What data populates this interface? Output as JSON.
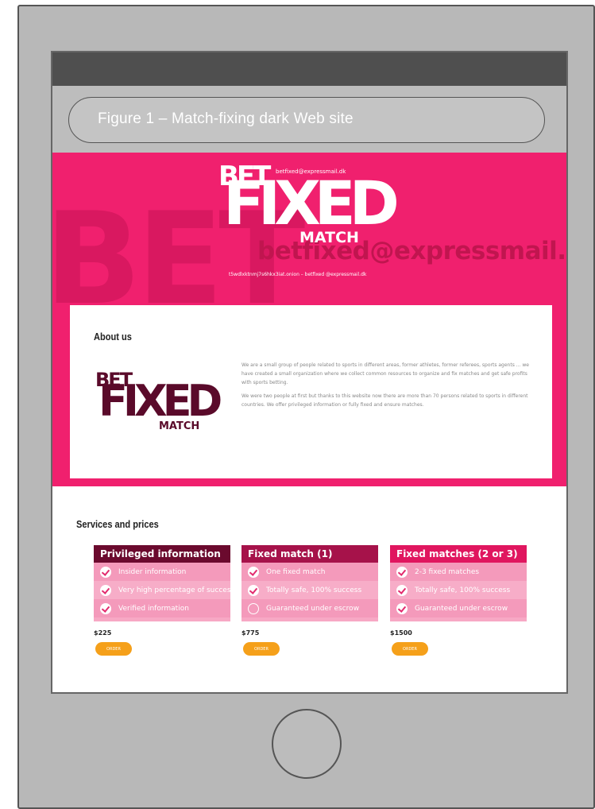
{
  "figure": {
    "caption": "Figure 1 – Match-fixing dark Web site"
  },
  "site": {
    "header": {
      "bg_big_text": "BET",
      "bg_email": "betfixed@expressmail.dk",
      "logo": {
        "bet": "BET",
        "fixed": "FIXED",
        "match": "MATCH",
        "tiny": "betfixed@expressmail.dk"
      },
      "tagline": "t5wdlxktnmj7s6hkx3iat.onion – betfixed @expressmail.dk"
    },
    "about": {
      "title": "About us",
      "logo": {
        "bet": "BET",
        "fixed": "FIXED",
        "match": "MATCH"
      },
      "paragraphs": [
        "We are a small group of people related to sports in different areas, former athletes, former referees, sports agents ... we have created a small organization where we collect common resources to organize and fix matches and get safe profits with sports betting.",
        "We were two people at first but thanks to this website now there are more than 70 persons related to sports in different countries. We offer privileged information or fully fixed and ensure matches."
      ]
    },
    "services": {
      "title": "Services and prices",
      "cards": [
        {
          "name": "Privileged information",
          "color": "#6b0a2e",
          "features": [
            "Insider information",
            "Very high percentage of success",
            "Verified information"
          ],
          "checked": [
            true,
            true,
            true
          ],
          "price": "$225",
          "order_label": "ORDER"
        },
        {
          "name": "Fixed match (1)",
          "color": "#a6124a",
          "features": [
            "One fixed match",
            "Totally safe, 100% success",
            "Guaranteed under escrow"
          ],
          "checked": [
            true,
            true,
            false
          ],
          "price": "$775",
          "order_label": "ORDER"
        },
        {
          "name": "Fixed matches (2 or 3)",
          "color": "#e0165f",
          "features": [
            "2-3 fixed matches",
            "Totally safe, 100% success",
            "Guaranteed under escrow"
          ],
          "checked": [
            true,
            true,
            true
          ],
          "price": "$1500",
          "order_label": "ORDER"
        }
      ]
    }
  }
}
